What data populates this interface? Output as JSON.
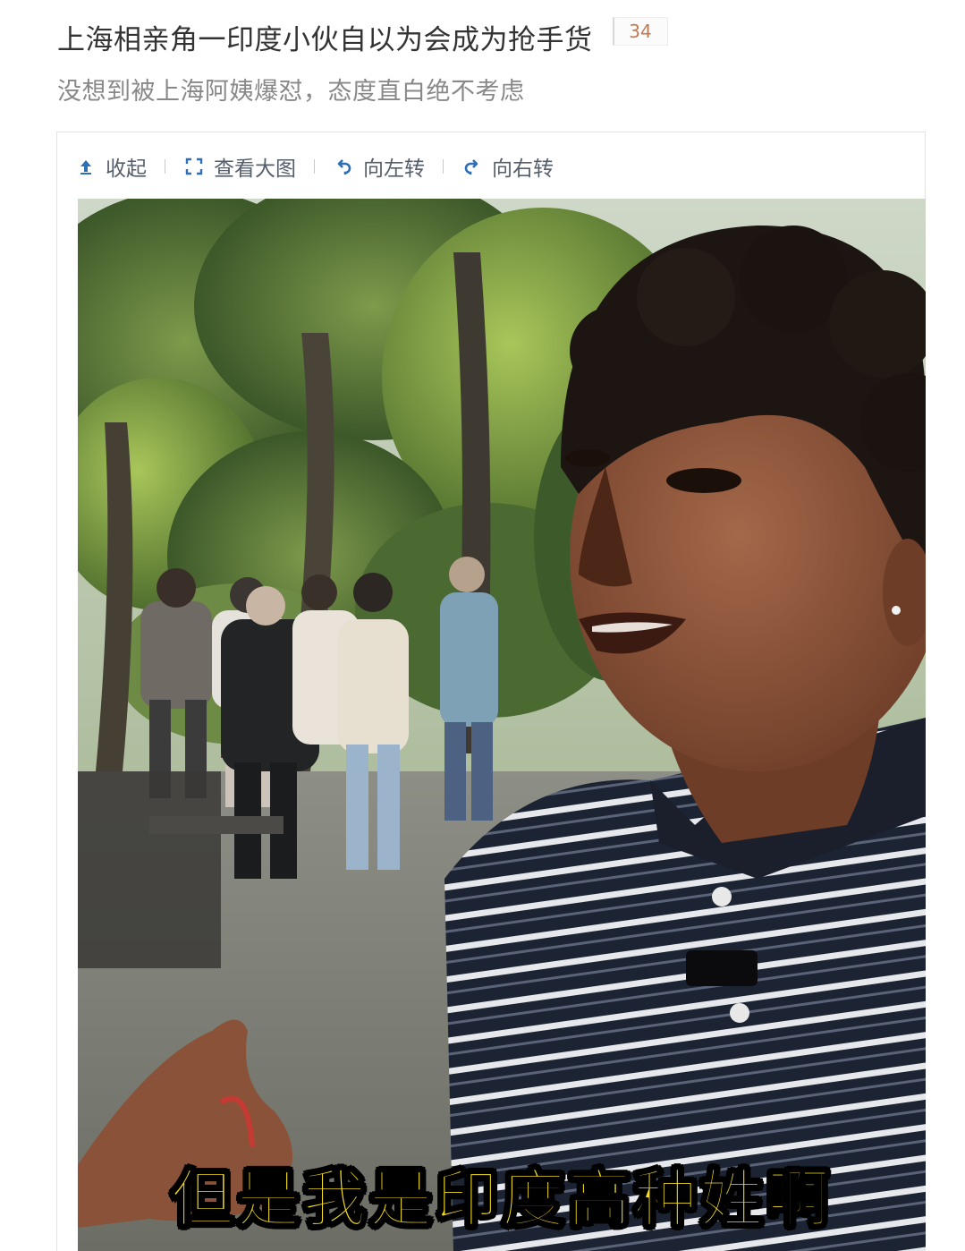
{
  "article": {
    "title": "上海相亲角一印度小伙自以为会成为抢手货",
    "comment_count": "34",
    "subtitle": "没想到被上海阿姨爆怼，态度直白绝不考虑"
  },
  "toolbar": {
    "collapse_label": "收起",
    "view_large_label": "查看大图",
    "rotate_left_label": "向左转",
    "rotate_right_label": "向右转"
  },
  "photo": {
    "caption": "但是我是印度高种姓啊"
  }
}
